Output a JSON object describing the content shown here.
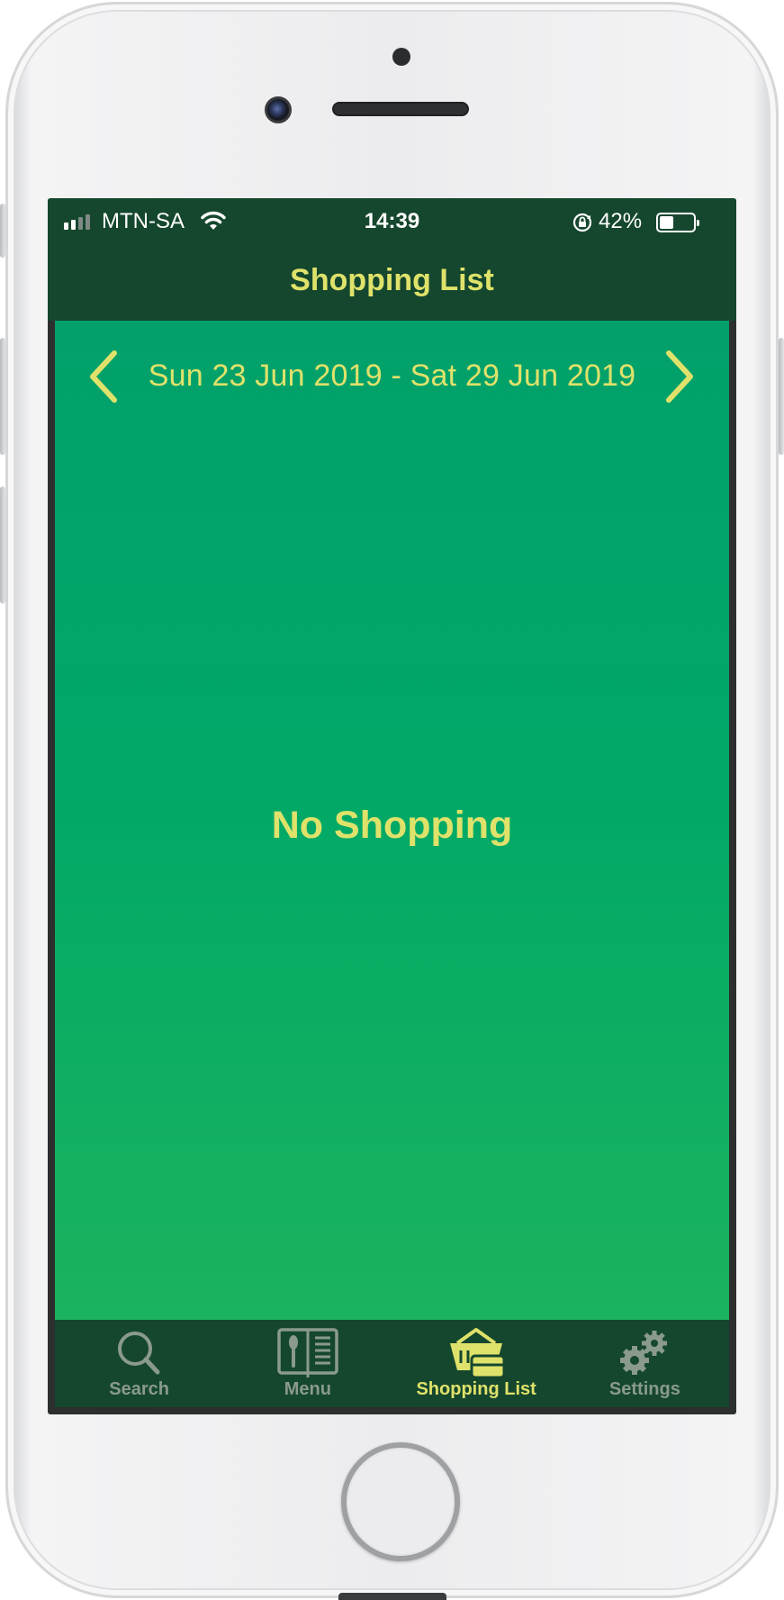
{
  "status_bar": {
    "carrier": "MTN-SA",
    "time": "14:39",
    "battery_percent": "42%",
    "battery_level": 0.42
  },
  "nav": {
    "title": "Shopping List"
  },
  "week_selector": {
    "range_label": "Sun 23 Jun 2019 - Sat 29 Jun 2019",
    "prev_icon": "chevron-left-icon",
    "next_icon": "chevron-right-icon"
  },
  "content": {
    "empty_message": "No Shopping"
  },
  "tabs": [
    {
      "label": "Search",
      "icon": "search-icon",
      "active": false
    },
    {
      "label": "Menu",
      "icon": "menu-book-icon",
      "active": false
    },
    {
      "label": "Shopping List",
      "icon": "shopping-basket-icon",
      "active": true
    },
    {
      "label": "Settings",
      "icon": "gears-icon",
      "active": false
    }
  ],
  "colors": {
    "bar_background": "#15472e",
    "content_top": "#03a06b",
    "content_bottom": "#1bb35e",
    "accent_yellow": "#dfe26a",
    "inactive_tab": "#8a9a8d"
  }
}
